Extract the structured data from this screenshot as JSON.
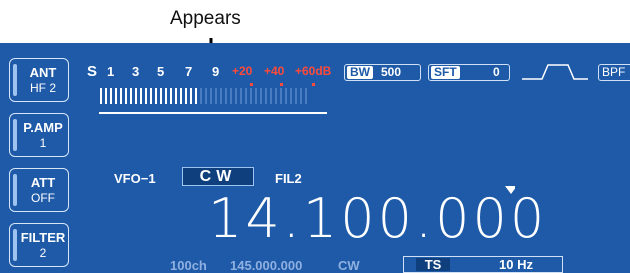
{
  "annotation": "Appears",
  "side_buttons": [
    {
      "top": "ANT",
      "bottom": "HF 2"
    },
    {
      "top": "P.AMP",
      "bottom": "1"
    },
    {
      "top": "ATT",
      "bottom": "OFF"
    },
    {
      "top": "FILTER",
      "bottom": "2"
    }
  ],
  "meter": {
    "s_label": "S",
    "scale": [
      "1",
      "3",
      "5",
      "7",
      "9"
    ],
    "over_scale": [
      "+20",
      "+40",
      "+60dB"
    ]
  },
  "bw": {
    "label": "BW",
    "value": "500"
  },
  "sft": {
    "label": "SFT",
    "value": "0"
  },
  "bpf": "BPF",
  "vfo": "VFO−1",
  "mode": "CW",
  "fil": "FIL2",
  "frequency": "14.100.000",
  "memory": {
    "channel": "100ch",
    "frequency": "145.000.000",
    "mode": "CW"
  },
  "ts": {
    "label": "TS",
    "value": "10 Hz"
  },
  "colors": {
    "screen_bg": "#1e5aa8",
    "red": "#ff4a3a"
  }
}
